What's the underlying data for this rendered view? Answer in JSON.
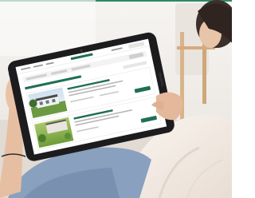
{
  "app": {
    "brand_wordmark": "",
    "listing_heading": ""
  },
  "colors": {
    "accent_green": "#1f6f54",
    "top_border": "#2d8a66",
    "screen_bg": "#ffffff",
    "tablet_body": "#1c1c1e",
    "wall": "#f1efec"
  },
  "listings": [
    {
      "name": "",
      "action": ""
    },
    {
      "name": "",
      "action": ""
    }
  ]
}
